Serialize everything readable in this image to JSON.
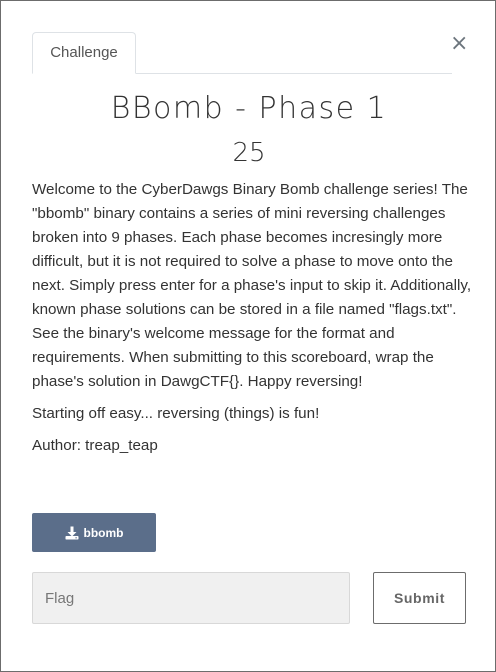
{
  "modal": {
    "close_glyph": "×",
    "tab_label": "Challenge",
    "title": "BBomb - Phase 1",
    "value": "25",
    "description": [
      "Welcome to the CyberDawgs Binary Bomb challenge series! The \"bbomb\" binary contains a series of mini reversing challenges broken into 9 phases. Each phase becomes incresingly more difficult, but it is not required to solve a phase to move onto the next. Simply press enter for a phase's input to skip it. Additionally, known phase solutions can be stored in a file named \"flags.txt\". See the binary's welcome message for the format and requirements. When submitting to this scoreboard, wrap the phase's solution in DawgCTF{}. Happy reversing!",
      "Starting off easy... reversing (things) is fun!",
      "Author: treap_teap"
    ],
    "download": {
      "label": "bbomb",
      "icon": "download-icon"
    },
    "flag_input": {
      "placeholder": "Flag",
      "value": ""
    },
    "submit_label": "Submit"
  },
  "colors": {
    "download_bg": "#5b6e8a",
    "input_bg": "#f0f0f0",
    "border": "#6c6c6c"
  }
}
